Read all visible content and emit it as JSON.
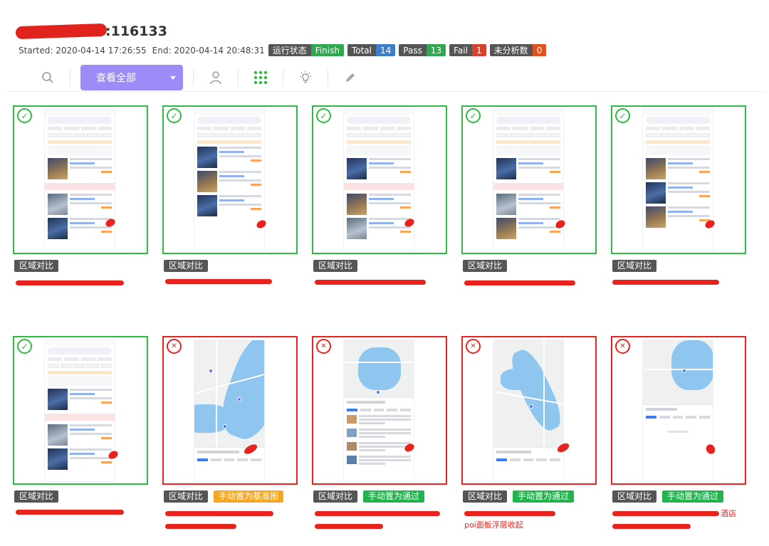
{
  "header": {
    "title_suffix": ":116133",
    "started_label": "Started:",
    "started_value": "2020-04-14 17:26:55",
    "end_label": "End:",
    "end_value": "2020-04-14 20:48:31"
  },
  "badges": {
    "status": {
      "k": "运行状态",
      "v": "Finish"
    },
    "total": {
      "k": "Total",
      "v": "14"
    },
    "pass": {
      "k": "Pass",
      "v": "13"
    },
    "fail": {
      "k": "Fail",
      "v": "1"
    },
    "unanalyzed": {
      "k": "未分析数",
      "v": "0"
    }
  },
  "toolbar": {
    "view_all_label": "查看全部",
    "icons": [
      "search-icon",
      "user-icon",
      "grid-icon",
      "bulb-icon",
      "pen-icon"
    ]
  },
  "colors": {
    "pass_border": "#2cbd40",
    "fail_border": "#e8221c",
    "primary_button": "#9b8cf8",
    "tag_gray": "#555555",
    "tag_orange": "#f5a623",
    "tag_green": "#22b34c"
  },
  "cards": [
    {
      "status": "pass",
      "shot": "list",
      "tags": [
        "区域对比"
      ],
      "desc": ""
    },
    {
      "status": "pass",
      "shot": "list",
      "tags": [
        "区域对比"
      ],
      "desc": ""
    },
    {
      "status": "pass",
      "shot": "list",
      "tags": [
        "区域对比"
      ],
      "desc": ""
    },
    {
      "status": "pass",
      "shot": "list",
      "tags": [
        "区域对比"
      ],
      "desc": ""
    },
    {
      "status": "pass",
      "shot": "list",
      "tags": [
        "区域对比"
      ],
      "desc": ""
    },
    {
      "status": "pass",
      "shot": "list",
      "tags": [
        "区域对比"
      ],
      "desc": ""
    },
    {
      "status": "fail",
      "shot": "map",
      "tags": [
        "区域对比",
        "手动置为基准图"
      ],
      "desc": ""
    },
    {
      "status": "fail",
      "shot": "map",
      "tags": [
        "区域对比",
        "手动置为通过"
      ],
      "desc": ""
    },
    {
      "status": "fail",
      "shot": "map",
      "tags": [
        "区域对比",
        "手动置为通过"
      ],
      "desc": "poi面板浮层收起"
    },
    {
      "status": "fail",
      "shot": "map",
      "tags": [
        "区域对比",
        "手动置为通过"
      ],
      "desc": "酒店"
    }
  ]
}
